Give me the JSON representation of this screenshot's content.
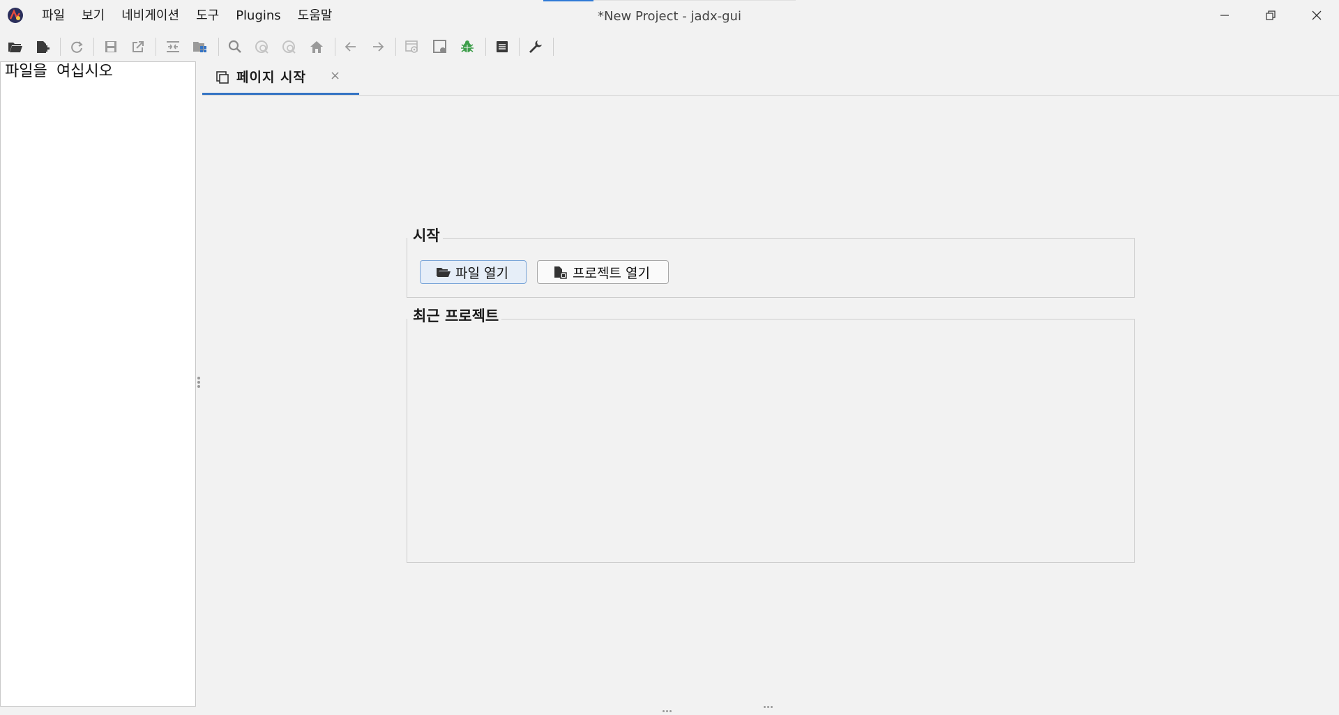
{
  "window": {
    "title": "*New Project - jadx-gui"
  },
  "menu": [
    {
      "id": "file",
      "label": "파일"
    },
    {
      "id": "view",
      "label": "보기"
    },
    {
      "id": "navigation",
      "label": "네비게이션"
    },
    {
      "id": "tools",
      "label": "도구"
    },
    {
      "id": "plugins",
      "label": "Plugins"
    },
    {
      "id": "help",
      "label": "도움말"
    }
  ],
  "toolbar": {
    "icons": [
      "open-folder-icon",
      "add-files-icon",
      "reload-icon",
      "save-all-icon",
      "export-icon",
      "sync-tree-icon",
      "flatten-packages-icon",
      "text-search-icon",
      "class-search-icon",
      "usage-search-icon",
      "home-icon",
      "back-arrow-icon",
      "forward-arrow-icon",
      "deobfuscation-icon",
      "quark-icon",
      "debugger-icon",
      "log-viewer-icon",
      "preferences-wrench-icon"
    ]
  },
  "left_panel": {
    "message": "파일을 여십시오"
  },
  "tabs": [
    {
      "label": "페이지 시작",
      "close": "×"
    }
  ],
  "start_page": {
    "start_group": {
      "title": "시작",
      "open_file_button": "파일 열기",
      "open_project_button": "프로젝트 열기"
    },
    "recent_group": {
      "title": "최근 프로젝트",
      "items": []
    }
  },
  "colors": {
    "accent": "#3574c4",
    "debug_green": "#3d9e4a",
    "background": "#f2f2f2"
  }
}
